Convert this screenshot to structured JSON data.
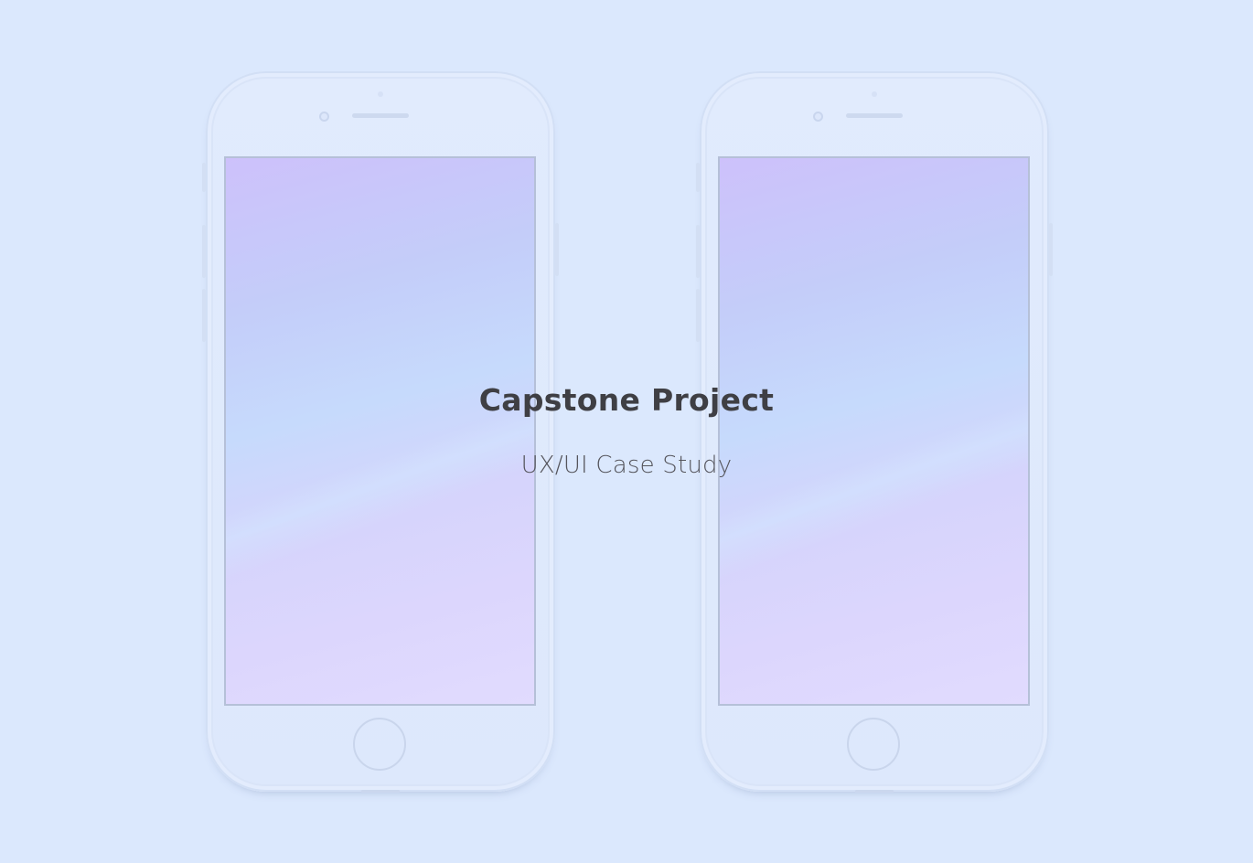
{
  "title": "Capstone Project",
  "subtitle": "UX/UI Case Study",
  "colors": {
    "background": "#dbe8fd",
    "phone_body": "#e1ebfd",
    "screen_border": "#b5c0d8",
    "screen_gradient_top": "#cdc1fb",
    "screen_gradient_mid": "#c6dafc",
    "screen_gradient_bottom": "#e1dbfe",
    "title_text": "#3f3f44",
    "subtitle_text": "#55555c"
  },
  "devices": [
    {
      "name": "phone-mockup-left"
    },
    {
      "name": "phone-mockup-right"
    }
  ]
}
